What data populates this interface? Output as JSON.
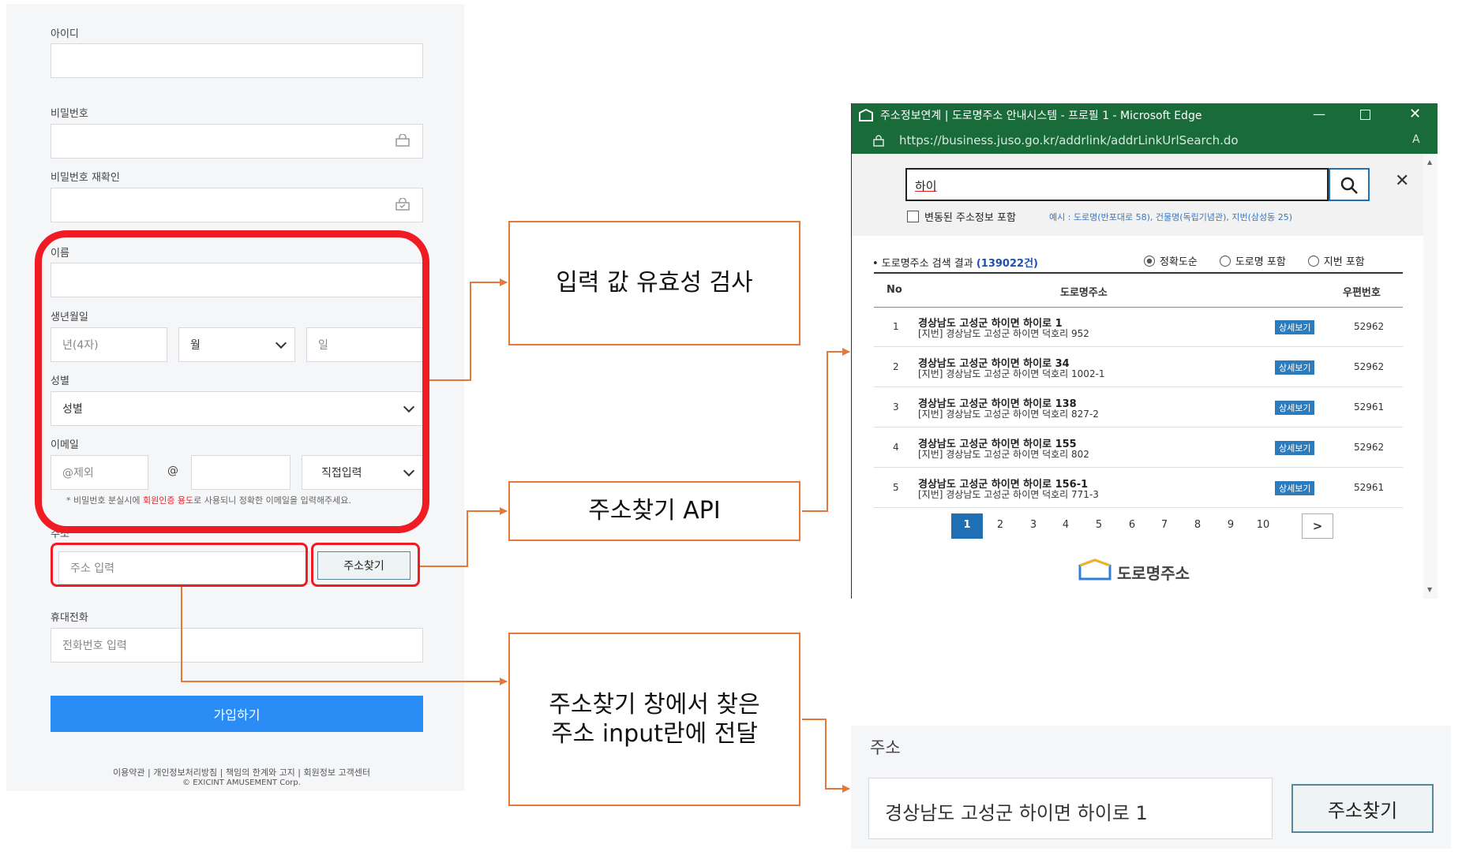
{
  "form": {
    "id_label": "아이디",
    "pw_label": "비밀번호",
    "pw_confirm_label": "비밀번호 재확인",
    "name_label": "이름",
    "birth_label": "생년월일",
    "birth_year_placeholder": "년(4자)",
    "birth_month_value": "월",
    "birth_day_placeholder": "일",
    "gender_label": "성별",
    "gender_value": "성별",
    "email_label": "이메일",
    "email_local_placeholder": "@제외",
    "email_at": "@",
    "email_domain_value": "직접입력",
    "note_prefix": "* 비밀번호 분실시에 ",
    "note_red": "회원인증 용도",
    "note_suffix": "로 사용되니 정확한 이메일을 입력해주세요.",
    "address_label": "주소",
    "address_placeholder": "주소 입력",
    "address_button": "주소찾기",
    "phone_label": "휴대전화",
    "phone_placeholder": "전화번호 입력",
    "submit_button": "가입하기",
    "footer_links": "이용약관 | 개인정보처리방침 | 책임의 한계와 고지 | 회원정보 고객센터",
    "copyright": "© EXICINT AMUSEMENT Corp."
  },
  "flow": {
    "validation": "입력 값 유효성 검사",
    "api": "주소찾기 API",
    "transfer_line1": "주소찾기 창에서 찾은",
    "transfer_line2": "주소 input란에 전달"
  },
  "popup": {
    "title": "주소정보연계 | 도로명주소 안내시스템 - 프로필 1 - Microsoft Edge",
    "url": "https://business.juso.go.kr/addrlink/addrLinkUrlSearch.do",
    "url_right": "A",
    "search_value": "하이",
    "checkbox_label": "변동된 주소정보 포함",
    "example_text": "예시 : 도로명(반포대로 58), 건물명(독립기념관), 지번(삼성동 25)",
    "result_title": "• 도로명주소 검색 결과",
    "result_count": "(139022건)",
    "radio_options": [
      "정확도순",
      "도로명 포함",
      "지번 포함"
    ],
    "col_no": "No",
    "col_road": "도로명주소",
    "col_zip": "우편번호",
    "detail_label": "상세보기",
    "rows": [
      {
        "no": "1",
        "road": "경상남도 고성군 하이면 하이로 1",
        "jibun": "[지번] 경상남도 고성군 하이면 덕호리 952",
        "zip": "52962"
      },
      {
        "no": "2",
        "road": "경상남도 고성군 하이면 하이로 34",
        "jibun": "[지번] 경상남도 고성군 하이면 덕호리 1002-1",
        "zip": "52962"
      },
      {
        "no": "3",
        "road": "경상남도 고성군 하이면 하이로 138",
        "jibun": "[지번] 경상남도 고성군 하이면 덕호리 827-2",
        "zip": "52961"
      },
      {
        "no": "4",
        "road": "경상남도 고성군 하이면 하이로 155",
        "jibun": "[지번] 경상남도 고성군 하이면 덕호리 802",
        "zip": "52962"
      },
      {
        "no": "5",
        "road": "경상남도 고성군 하이면 하이로 156-1",
        "jibun": "[지번] 경상남도 고성군 하이면 덕호리 771-3",
        "zip": "52961"
      }
    ],
    "pages": [
      "1",
      "2",
      "3",
      "4",
      "5",
      "6",
      "7",
      "8",
      "9",
      "10"
    ],
    "next": ">",
    "logo_text": "도로명주소"
  },
  "result": {
    "label": "주소",
    "value": "경상남도 고성군 하이면 하이로 1",
    "button": "주소찾기"
  },
  "colors": {
    "highlight": "#ef1c24",
    "flow_border": "#e6793a",
    "primary_button": "#2b8cf6",
    "titlebar": "#1a6b3a"
  }
}
